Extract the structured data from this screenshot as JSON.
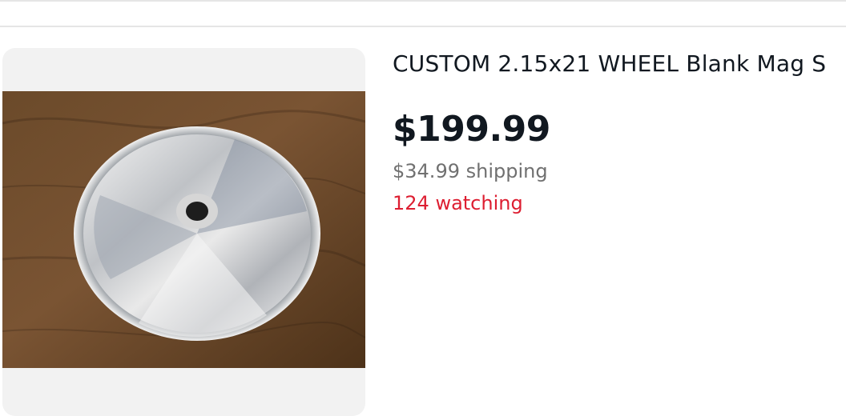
{
  "listing": {
    "title": "CUSTOM 2.15x21 WHEEL Blank Mag S",
    "price": "$199.99",
    "shipping": "$34.99 shipping",
    "watching": "124 watching",
    "image_subject": "chrome wheel blank disc on wooden surface"
  },
  "colors": {
    "text_primary": "#111820",
    "text_secondary": "#707070",
    "watching_red": "#dd1e31",
    "image_bg": "#f2f2f2"
  }
}
